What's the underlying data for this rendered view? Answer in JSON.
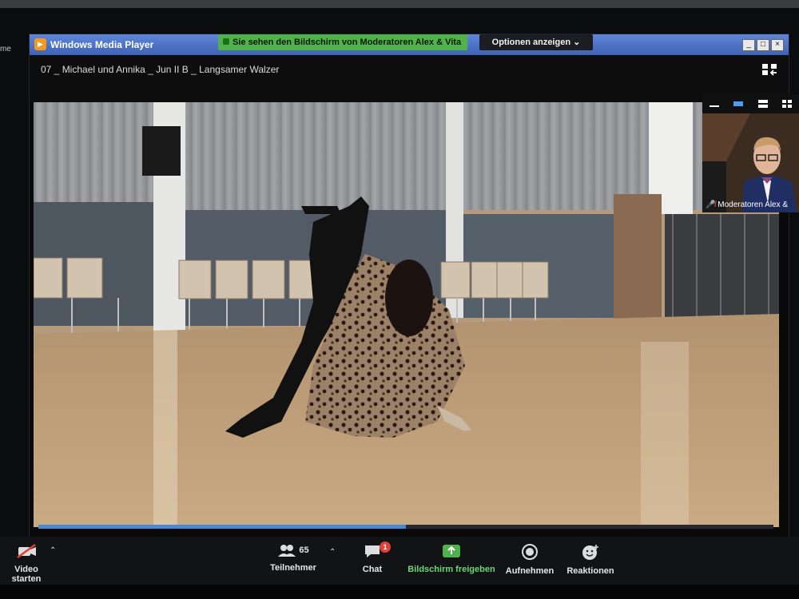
{
  "player": {
    "title": "Windows Media Player",
    "track_title": "07 _ Michael  und Annika _ Jun II B _ Langsamer Walzer",
    "progress": 0.5,
    "window_buttons": [
      "_",
      "□",
      "×"
    ]
  },
  "share": {
    "banner_text": "Sie sehen den Bildschirm von Moderatoren Alex & Vita",
    "options_label": "Optionen anzeigen ⌄"
  },
  "left_edge_text": "me",
  "tile": {
    "participant_name": "Moderatoren Alex &"
  },
  "toolbar": {
    "video_label": "Video starten",
    "participants_label": "Teilnehmer",
    "participants_count": "65",
    "chat_label": "Chat",
    "chat_badge": "1",
    "share_label": "Bildschirm freigeben",
    "record_label": "Aufnehmen",
    "reactions_label": "Reaktionen"
  },
  "colors": {
    "share_green": "#4fb24a",
    "wmp_blue": "#3e62b6",
    "badge_red": "#e0403a"
  }
}
